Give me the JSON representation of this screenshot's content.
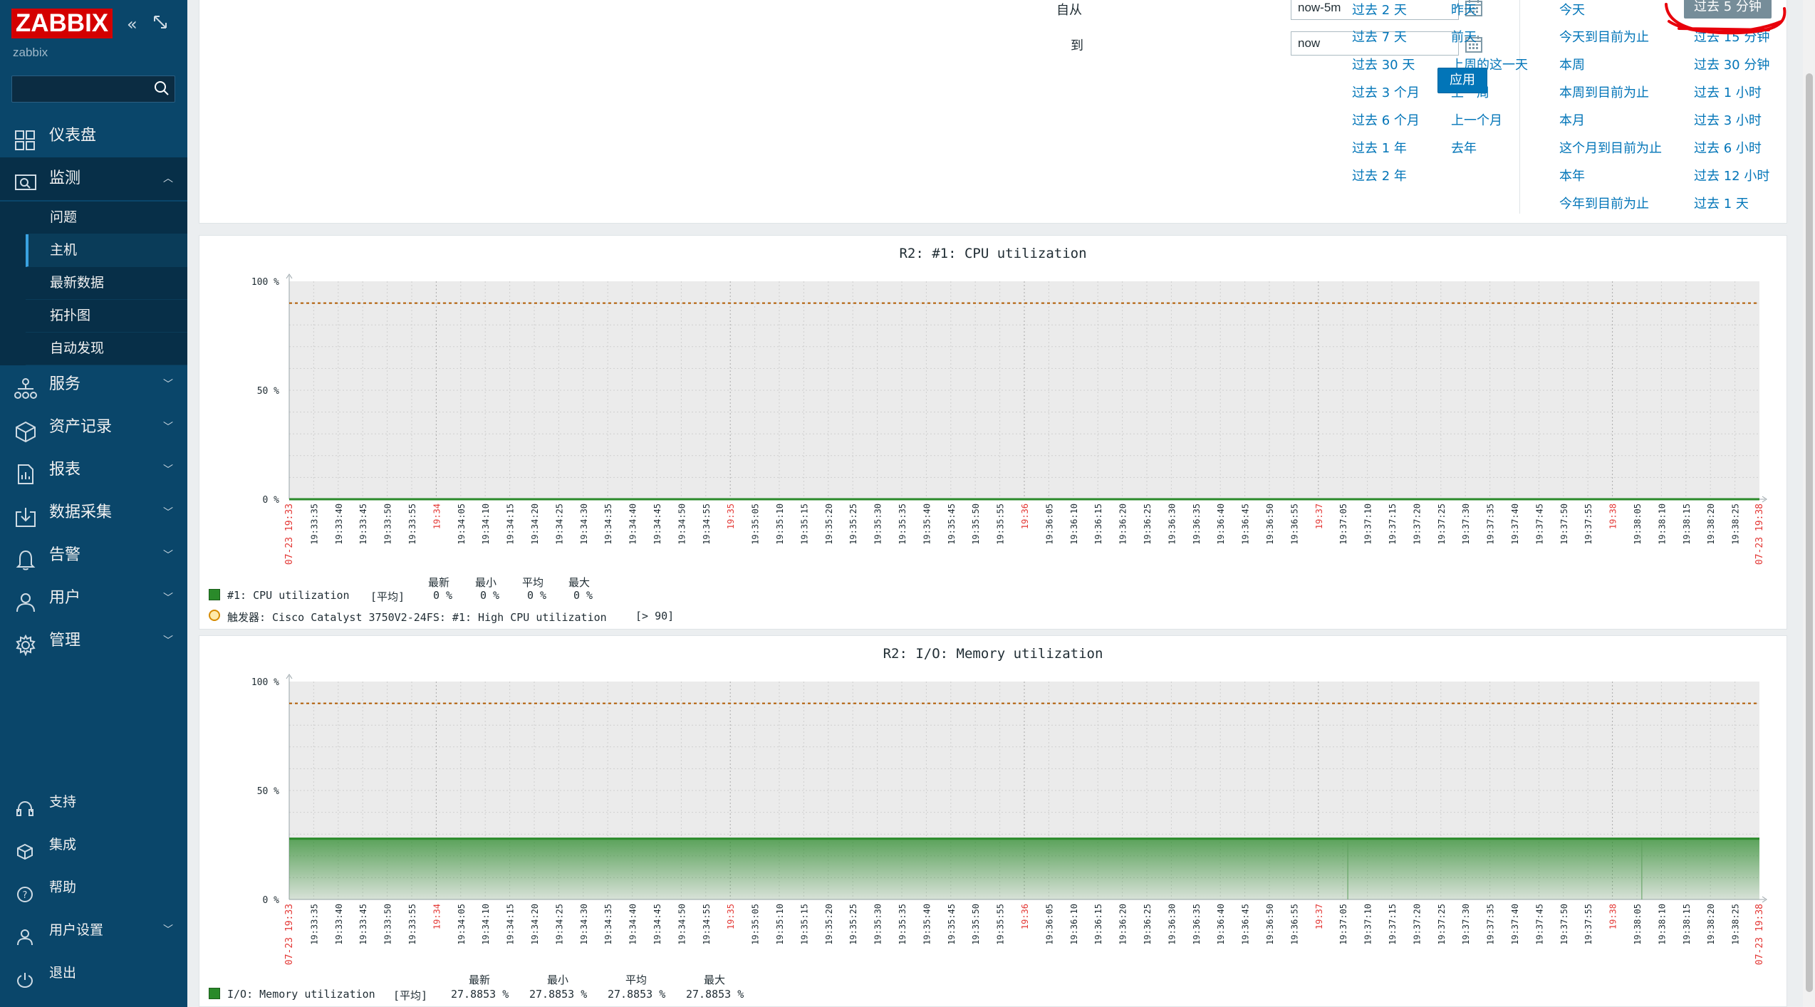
{
  "brand": {
    "logo": "ZABBIX",
    "server_name": "zabbix"
  },
  "sidebar": {
    "search_placeholder": "",
    "menu": [
      {
        "label": "仪表盘",
        "icon": "dashboard-icon"
      },
      {
        "label": "监测",
        "icon": "monitoring-icon"
      },
      {
        "label": "服务",
        "icon": "services-icon"
      },
      {
        "label": "资产记录",
        "icon": "inventory-icon"
      },
      {
        "label": "报表",
        "icon": "reports-icon"
      },
      {
        "label": "数据采集",
        "icon": "data-collection-icon"
      },
      {
        "label": "告警",
        "icon": "alerts-icon"
      },
      {
        "label": "用户",
        "icon": "users-icon"
      },
      {
        "label": "管理",
        "icon": "administration-icon"
      }
    ],
    "submenu": [
      "问题",
      "主机",
      "最新数据",
      "拓扑图",
      "自动发现"
    ],
    "selected_submenu": "主机",
    "footer": [
      {
        "label": "支持",
        "icon": "support-icon"
      },
      {
        "label": "集成",
        "icon": "integrations-icon"
      },
      {
        "label": "帮助",
        "icon": "help-icon"
      },
      {
        "label": "用户设置",
        "icon": "user-settings-icon"
      },
      {
        "label": "退出",
        "icon": "sign-out-icon"
      }
    ]
  },
  "filter": {
    "from_label": "自从",
    "from_value": "now-5m",
    "to_label": "到",
    "to_value": "now",
    "apply_label": "应用"
  },
  "quick_ranges": {
    "col1": [
      "过去 2 天",
      "过去 7 天",
      "过去 30 天",
      "过去 3 个月",
      "过去 6 个月",
      "过去 1 年",
      "过去 2 年"
    ],
    "col2": [
      "昨天",
      "前天",
      "上周的这一天",
      "上一周",
      "上一个月",
      "去年"
    ],
    "col3": [
      "今天",
      "今天到目前为止",
      "本周",
      "本周到目前为止",
      "本月",
      "这个月到目前为止",
      "本年",
      "今年到目前为止"
    ],
    "col4": [
      "过去 5 分钟",
      "过去 15 分钟",
      "过去 30 分钟",
      "过去 1 小时",
      "过去 3 小时",
      "过去 6 小时",
      "过去 12 小时",
      "过去 1 天"
    ],
    "selected": "过去 5 分钟"
  },
  "graphs": [
    {
      "title": "R2: #1: CPU utilization",
      "legend_headers": [
        "最新",
        "最小",
        "平均",
        "最大"
      ],
      "item_label": "#1: CPU utilization",
      "item_func": "[平均]",
      "item_values": [
        "0 %",
        "0 %",
        "0 %",
        "0 %"
      ],
      "trigger_label": "触发器: Cisco Catalyst 3750V2-24FS: #1: High CPU utilization",
      "trigger_cond": "[> 90]",
      "chart_data": {
        "type": "line",
        "y_ticks": [
          "100 %",
          "50 %",
          "0 %"
        ],
        "ylim": [
          0,
          100
        ],
        "threshold": 90,
        "x_start": "19:33:33",
        "x_end": "19:38:33",
        "date_label": "07-23",
        "series": [
          {
            "name": "#1: CPU utilization",
            "values": [
              0,
              0
            ]
          }
        ]
      }
    },
    {
      "title": "R2: I/O: Memory utilization",
      "legend_headers": [
        "最新",
        "最小",
        "平均",
        "最大"
      ],
      "item_label": "I/O: Memory utilization",
      "item_func": "[平均]",
      "item_values": [
        "27.8853 %",
        "27.8853 %",
        "27.8853 %",
        "27.8853 %"
      ],
      "chart_data": {
        "type": "area",
        "y_ticks": [
          "100 %",
          "50 %",
          "0 %"
        ],
        "ylim": [
          0,
          100
        ],
        "threshold": 90,
        "x_start": "19:33:33",
        "x_end": "19:38:33",
        "date_label": "07-23",
        "series": [
          {
            "name": "I/O: Memory utilization",
            "values": [
              27.8853,
              27.8853
            ]
          }
        ]
      }
    }
  ],
  "time_axis": {
    "minor_labels": [
      "19:33:35",
      "19:33:40",
      "19:33:45",
      "19:33:50",
      "19:33:55",
      "19:34",
      "19:34:05",
      "19:34:10",
      "19:34:15",
      "19:34:20",
      "19:34:25",
      "19:34:30",
      "19:34:35",
      "19:34:40",
      "19:34:45",
      "19:34:50",
      "19:34:55",
      "19:35",
      "19:35:05",
      "19:35:10",
      "19:35:15",
      "19:35:20",
      "19:35:25",
      "19:35:30",
      "19:35:35",
      "19:35:40",
      "19:35:45",
      "19:35:50",
      "19:35:55",
      "19:36",
      "19:36:05",
      "19:36:10",
      "19:36:15",
      "19:36:20",
      "19:36:25",
      "19:36:30",
      "19:36:35",
      "19:36:40",
      "19:36:45",
      "19:36:50",
      "19:36:55",
      "19:37",
      "19:37:05",
      "19:37:10",
      "19:37:15",
      "19:37:20",
      "19:37:25",
      "19:37:30",
      "19:37:35",
      "19:37:40",
      "19:37:45",
      "19:37:50",
      "19:37:55",
      "19:38",
      "19:38:05",
      "19:38:10",
      "19:38:15",
      "19:38:20",
      "19:38:25"
    ],
    "start_label": "07-23 19:33",
    "end_label": "07-23 19:38"
  },
  "colors": {
    "sidebar": "#0a466a",
    "accent": "#0275b8",
    "series_green": "#2a8a2a",
    "threshold": "#b05a00",
    "red_label": "#e33734",
    "annotation": "#e8000b"
  }
}
